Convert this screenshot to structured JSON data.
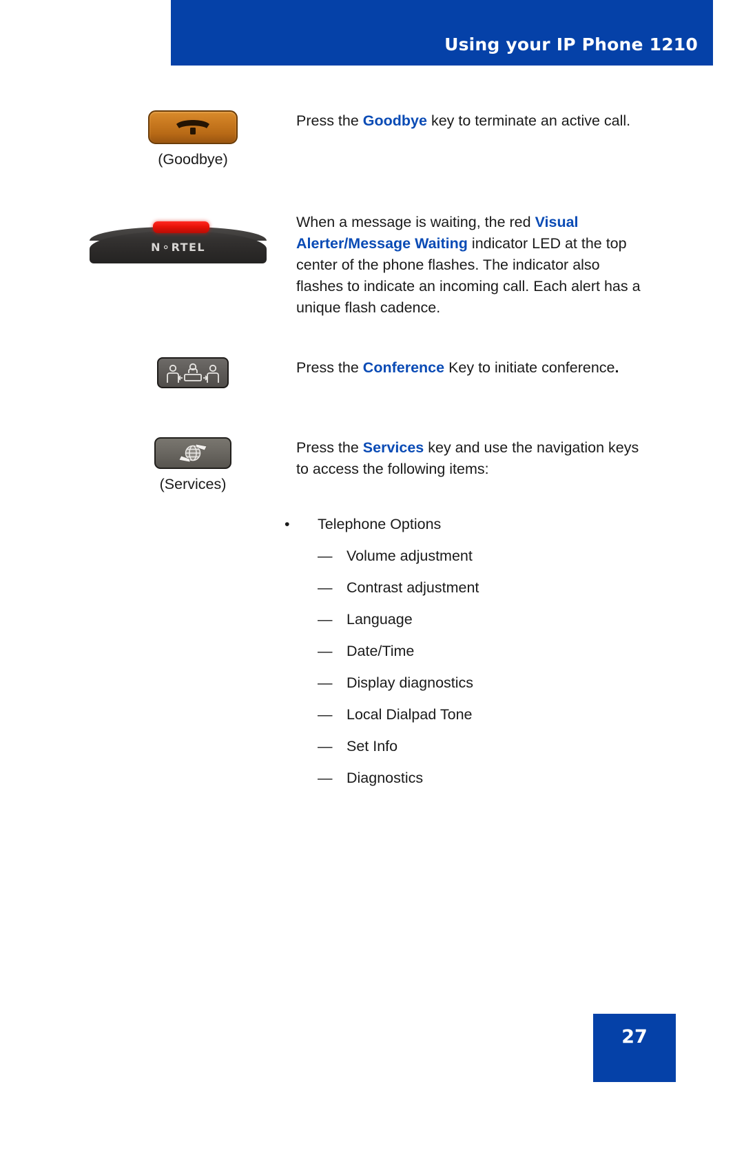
{
  "header": {
    "title": "Using your IP Phone 1210",
    "bar_color": "#0541A8"
  },
  "accent_color": "#0A4BB5",
  "rows": [
    {
      "key_label": "(Goodbye)",
      "icon_name": "goodbye-key-icon",
      "text_parts": [
        {
          "t": "Press the ",
          "style": "normal"
        },
        {
          "t": "Goodbye",
          "style": "keyword"
        },
        {
          "t": " key to terminate an active call.",
          "style": "normal"
        }
      ],
      "text_plain": "Press the Goodbye key to terminate an active call.",
      "lead": "Press the ",
      "keyword": "Goodbye",
      "tail": " key to terminate an active call."
    },
    {
      "key_label": "",
      "icon_name": "nortel-phone-led-photo",
      "photo_logo": "N RTEL",
      "photo_logo_left": "N",
      "photo_logo_right": "RTEL",
      "lead": "When a message is waiting, the red ",
      "keyword": "Visual Alerter",
      "separator": "/",
      "keyword2": "Message Waiting",
      "tail": " indicator LED at the top center of the phone flashes. The indicator also flashes to indicate an incoming call. Each alert has a unique flash cadence."
    },
    {
      "key_label": "",
      "icon_name": "conference-key-icon",
      "lead": "Press the ",
      "keyword": "Conference",
      "tail": " Key to initiate conference",
      "tail_bold": "."
    },
    {
      "key_label": "(Services)",
      "icon_name": "services-key-icon",
      "lead": "Press the ",
      "keyword": "Services",
      "tail": " key and use the navigation keys to access the following items:"
    }
  ],
  "services_list": {
    "bullet_symbol": "•",
    "dash_symbol": "—",
    "bullet_item": "Telephone Options",
    "sub_items": [
      "Volume adjustment",
      "Contrast adjustment",
      "Language",
      "Date/Time",
      "Display diagnostics",
      "Local Dialpad Tone",
      "Set Info",
      "Diagnostics"
    ]
  },
  "footer": {
    "page_number": "27"
  }
}
